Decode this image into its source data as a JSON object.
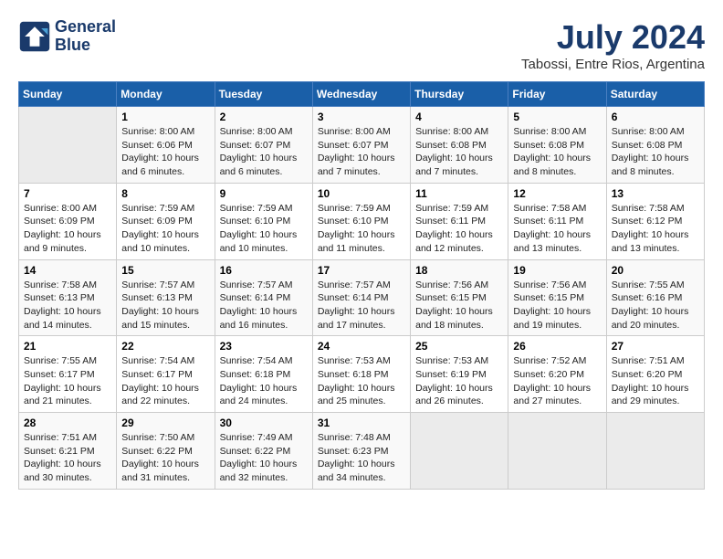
{
  "logo": {
    "line1": "General",
    "line2": "Blue"
  },
  "title": "July 2024",
  "location": "Tabossi, Entre Rios, Argentina",
  "days_of_week": [
    "Sunday",
    "Monday",
    "Tuesday",
    "Wednesday",
    "Thursday",
    "Friday",
    "Saturday"
  ],
  "weeks": [
    [
      {
        "num": "",
        "info": ""
      },
      {
        "num": "1",
        "info": "Sunrise: 8:00 AM\nSunset: 6:06 PM\nDaylight: 10 hours\nand 6 minutes."
      },
      {
        "num": "2",
        "info": "Sunrise: 8:00 AM\nSunset: 6:07 PM\nDaylight: 10 hours\nand 6 minutes."
      },
      {
        "num": "3",
        "info": "Sunrise: 8:00 AM\nSunset: 6:07 PM\nDaylight: 10 hours\nand 7 minutes."
      },
      {
        "num": "4",
        "info": "Sunrise: 8:00 AM\nSunset: 6:08 PM\nDaylight: 10 hours\nand 7 minutes."
      },
      {
        "num": "5",
        "info": "Sunrise: 8:00 AM\nSunset: 6:08 PM\nDaylight: 10 hours\nand 8 minutes."
      },
      {
        "num": "6",
        "info": "Sunrise: 8:00 AM\nSunset: 6:08 PM\nDaylight: 10 hours\nand 8 minutes."
      }
    ],
    [
      {
        "num": "7",
        "info": "Sunrise: 8:00 AM\nSunset: 6:09 PM\nDaylight: 10 hours\nand 9 minutes."
      },
      {
        "num": "8",
        "info": "Sunrise: 7:59 AM\nSunset: 6:09 PM\nDaylight: 10 hours\nand 10 minutes."
      },
      {
        "num": "9",
        "info": "Sunrise: 7:59 AM\nSunset: 6:10 PM\nDaylight: 10 hours\nand 10 minutes."
      },
      {
        "num": "10",
        "info": "Sunrise: 7:59 AM\nSunset: 6:10 PM\nDaylight: 10 hours\nand 11 minutes."
      },
      {
        "num": "11",
        "info": "Sunrise: 7:59 AM\nSunset: 6:11 PM\nDaylight: 10 hours\nand 12 minutes."
      },
      {
        "num": "12",
        "info": "Sunrise: 7:58 AM\nSunset: 6:11 PM\nDaylight: 10 hours\nand 13 minutes."
      },
      {
        "num": "13",
        "info": "Sunrise: 7:58 AM\nSunset: 6:12 PM\nDaylight: 10 hours\nand 13 minutes."
      }
    ],
    [
      {
        "num": "14",
        "info": "Sunrise: 7:58 AM\nSunset: 6:13 PM\nDaylight: 10 hours\nand 14 minutes."
      },
      {
        "num": "15",
        "info": "Sunrise: 7:57 AM\nSunset: 6:13 PM\nDaylight: 10 hours\nand 15 minutes."
      },
      {
        "num": "16",
        "info": "Sunrise: 7:57 AM\nSunset: 6:14 PM\nDaylight: 10 hours\nand 16 minutes."
      },
      {
        "num": "17",
        "info": "Sunrise: 7:57 AM\nSunset: 6:14 PM\nDaylight: 10 hours\nand 17 minutes."
      },
      {
        "num": "18",
        "info": "Sunrise: 7:56 AM\nSunset: 6:15 PM\nDaylight: 10 hours\nand 18 minutes."
      },
      {
        "num": "19",
        "info": "Sunrise: 7:56 AM\nSunset: 6:15 PM\nDaylight: 10 hours\nand 19 minutes."
      },
      {
        "num": "20",
        "info": "Sunrise: 7:55 AM\nSunset: 6:16 PM\nDaylight: 10 hours\nand 20 minutes."
      }
    ],
    [
      {
        "num": "21",
        "info": "Sunrise: 7:55 AM\nSunset: 6:17 PM\nDaylight: 10 hours\nand 21 minutes."
      },
      {
        "num": "22",
        "info": "Sunrise: 7:54 AM\nSunset: 6:17 PM\nDaylight: 10 hours\nand 22 minutes."
      },
      {
        "num": "23",
        "info": "Sunrise: 7:54 AM\nSunset: 6:18 PM\nDaylight: 10 hours\nand 24 minutes."
      },
      {
        "num": "24",
        "info": "Sunrise: 7:53 AM\nSunset: 6:18 PM\nDaylight: 10 hours\nand 25 minutes."
      },
      {
        "num": "25",
        "info": "Sunrise: 7:53 AM\nSunset: 6:19 PM\nDaylight: 10 hours\nand 26 minutes."
      },
      {
        "num": "26",
        "info": "Sunrise: 7:52 AM\nSunset: 6:20 PM\nDaylight: 10 hours\nand 27 minutes."
      },
      {
        "num": "27",
        "info": "Sunrise: 7:51 AM\nSunset: 6:20 PM\nDaylight: 10 hours\nand 29 minutes."
      }
    ],
    [
      {
        "num": "28",
        "info": "Sunrise: 7:51 AM\nSunset: 6:21 PM\nDaylight: 10 hours\nand 30 minutes."
      },
      {
        "num": "29",
        "info": "Sunrise: 7:50 AM\nSunset: 6:22 PM\nDaylight: 10 hours\nand 31 minutes."
      },
      {
        "num": "30",
        "info": "Sunrise: 7:49 AM\nSunset: 6:22 PM\nDaylight: 10 hours\nand 32 minutes."
      },
      {
        "num": "31",
        "info": "Sunrise: 7:48 AM\nSunset: 6:23 PM\nDaylight: 10 hours\nand 34 minutes."
      },
      {
        "num": "",
        "info": ""
      },
      {
        "num": "",
        "info": ""
      },
      {
        "num": "",
        "info": ""
      }
    ]
  ]
}
